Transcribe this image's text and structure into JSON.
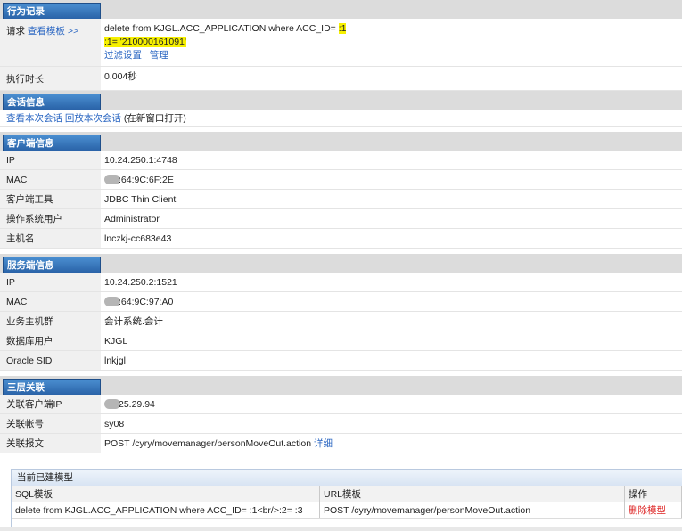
{
  "behavior": {
    "title": "行为记录",
    "request": {
      "label": "请求",
      "template_link": "查看模板 >>",
      "sql_main": "delete from KJGL.ACC_APPLICATION where ACC_ID= ",
      "sql_param": ":1",
      "bind_value": ":1= '210000161091'",
      "filter_link": "过滤设置",
      "manage_link": "管理"
    },
    "exec_time": {
      "label": "执行时长",
      "value": "0.004秒"
    }
  },
  "session": {
    "title": "会话信息",
    "view_link": "查看本次会话",
    "replay_link": "回放本次会话",
    "note": "(在新窗口打开)"
  },
  "client": {
    "title": "客户端信息",
    "rows": [
      {
        "label": "IP",
        "value": "10.24.250.1:4748"
      },
      {
        "label": "MAC",
        "value": ":64:9C:6F:2E"
      },
      {
        "label": "客户端工具",
        "value": "JDBC Thin Client"
      },
      {
        "label": "操作系统用户",
        "value": "Administrator"
      },
      {
        "label": "主机名",
        "value": "lnczkj-cc683e43"
      }
    ]
  },
  "server": {
    "title": "服务端信息",
    "rows": [
      {
        "label": "IP",
        "value": "10.24.250.2:1521"
      },
      {
        "label": "MAC",
        "value": ":64:9C:97:A0"
      },
      {
        "label": "业务主机群",
        "value": "会计系统.会计"
      },
      {
        "label": "数据库用户",
        "value": "KJGL"
      },
      {
        "label": "Oracle SID",
        "value": "lnkjgl"
      }
    ]
  },
  "three_tier": {
    "title": "三层关联",
    "client_ip": {
      "label": "关联客户端IP",
      "value": "25.29.94"
    },
    "account": {
      "label": "关联帐号",
      "value": "sy08"
    },
    "message": {
      "label": "关联报文",
      "value": "POST /cyry/movemanager/personMoveOut.action",
      "detail_link": "详细"
    }
  },
  "models": {
    "title": "当前已建模型",
    "headers": [
      "SQL模板",
      "URL模板",
      "操作"
    ],
    "row": {
      "sql": "delete from KJGL.ACC_APPLICATION where ACC_ID= :1<br/>:2= :3",
      "url": "POST /cyry/movemanager/personMoveOut.action",
      "action": "删除模型"
    }
  },
  "colors": {
    "tab": "#2a63a8",
    "link": "#2a66c2",
    "highlight": "#f6f000",
    "danger": "#dd2222"
  }
}
